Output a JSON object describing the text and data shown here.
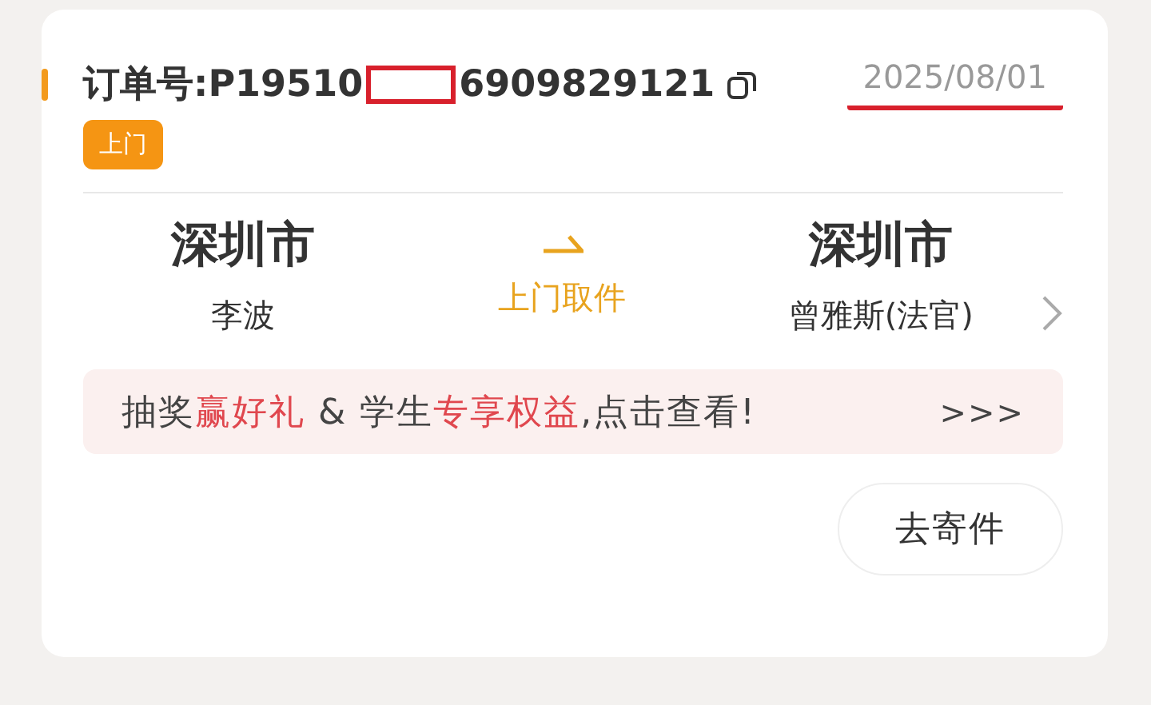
{
  "order": {
    "number_prefix": "订单号:P19510",
    "number_suffix": "6909829121",
    "date": "2025/08/01",
    "tag": "上门"
  },
  "route": {
    "from": {
      "city": "深圳市",
      "name": "李波"
    },
    "method": "上门取件",
    "to": {
      "city": "深圳市",
      "name": "曾雅斯(法官)"
    }
  },
  "promo": {
    "segments": [
      {
        "text": "抽奖",
        "highlight": false
      },
      {
        "text": "赢好礼",
        "highlight": true
      },
      {
        "text": " & 学生",
        "highlight": false
      },
      {
        "text": "专享权益",
        "highlight": true
      },
      {
        "text": ",点击查看!",
        "highlight": false
      }
    ],
    "more": ">>>"
  },
  "action_button": "去寄件"
}
